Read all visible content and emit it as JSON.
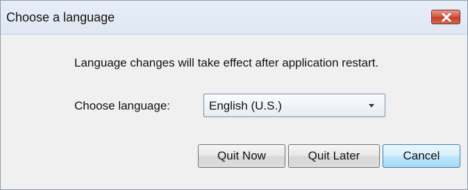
{
  "window": {
    "title": "Choose a language",
    "close_icon": "close-x-icon"
  },
  "dialog": {
    "message": "Language changes will take effect after application restart.",
    "language_label": "Choose language:",
    "language_select": {
      "selected": "English (U.S.)"
    }
  },
  "buttons": {
    "quit_now": "Quit Now",
    "quit_later": "Quit Later",
    "cancel": "Cancel"
  }
}
